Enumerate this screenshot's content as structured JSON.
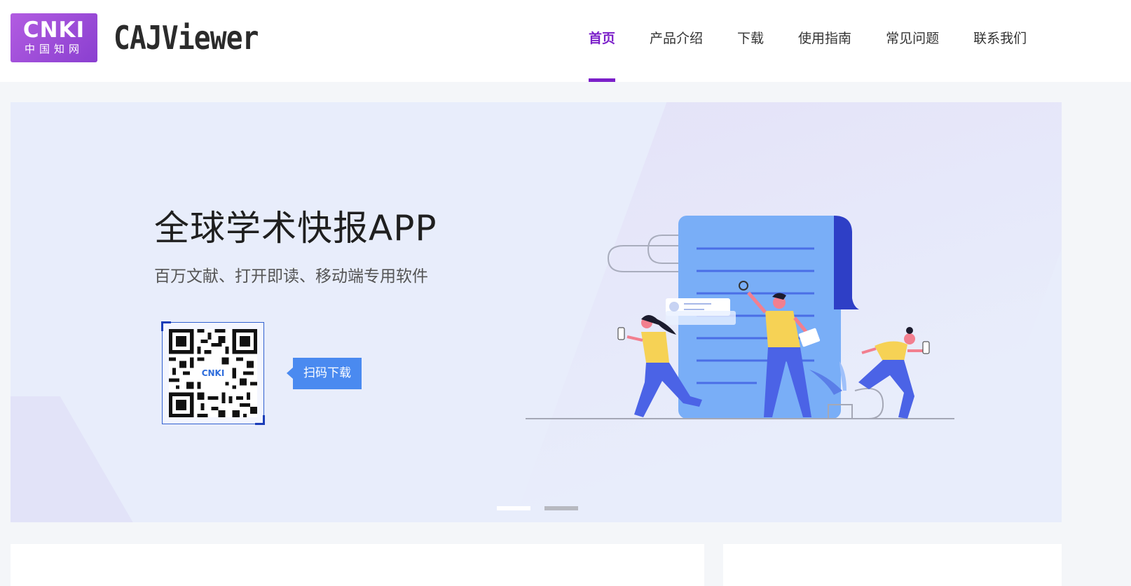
{
  "header": {
    "logo": {
      "main": "CNKI",
      "sub": "中国知网"
    },
    "product_name": "CAJViewer",
    "nav": [
      {
        "label": "首页",
        "active": true
      },
      {
        "label": "产品介绍",
        "active": false
      },
      {
        "label": "下载",
        "active": false
      },
      {
        "label": "使用指南",
        "active": false
      },
      {
        "label": "常见问题",
        "active": false
      },
      {
        "label": "联系我们",
        "active": false
      }
    ]
  },
  "banner": {
    "title": "全球学术快报APP",
    "subtitle": "百万文献、打开即读、移动端专用软件",
    "qr_logo": "CNKI",
    "scan_tip": "扫码下载",
    "carousel": {
      "count": 2,
      "active_index": 0
    }
  },
  "colors": {
    "accent": "#7b1fc9",
    "banner_bg": "#e8edfb",
    "tip_blue": "#4a8af0",
    "page_bg": "#f4f6f9"
  }
}
